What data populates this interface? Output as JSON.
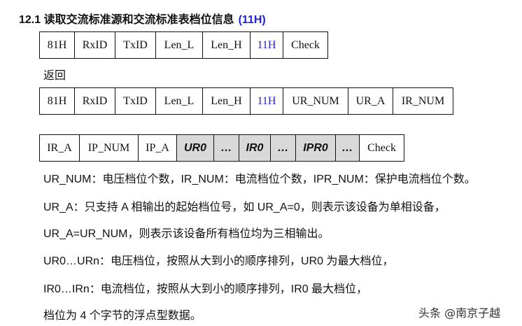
{
  "title": {
    "text": "12.1 读取交流标准源和交流标准表档位信息",
    "code": "(11H)"
  },
  "request": [
    "81H",
    "RxID",
    "TxID",
    "Len_L",
    "Len_H",
    "11H",
    "Check"
  ],
  "return_label": "返回",
  "response1": [
    "81H",
    "RxID",
    "TxID",
    "Len_L",
    "Len_H",
    "11H",
    "UR_NUM",
    "UR_A",
    "IR_NUM"
  ],
  "response2": [
    "IR_A",
    "IP_NUM",
    "IP_A",
    "UR0",
    "…",
    "IR0",
    "…",
    "IPR0",
    "…",
    "Check"
  ],
  "lines": [
    "UR_NUM：电压档位个数，IR_NUM：电流档位个数，IPR_NUM：保护电流档位个数。",
    "UR_A：只支持 A 相输出的起始档位号，如 UR_A=0，则表示该设备为单相设备，",
    "UR_A=UR_NUM，则表示该设备所有档位均为三相输出。",
    "UR0…URn：电压档位，按照从大到小的顺序排列，UR0 为最大档位，",
    "IR0…IRn：电流档位，按照从大到小的顺序排列，IR0 最大档位，",
    "档位为 4 个字节的浮点型数据。"
  ],
  "watermark": "头条 @南京子越",
  "colors": {
    "accent": "#1a1aee",
    "shaded": "#d9d9d9"
  }
}
